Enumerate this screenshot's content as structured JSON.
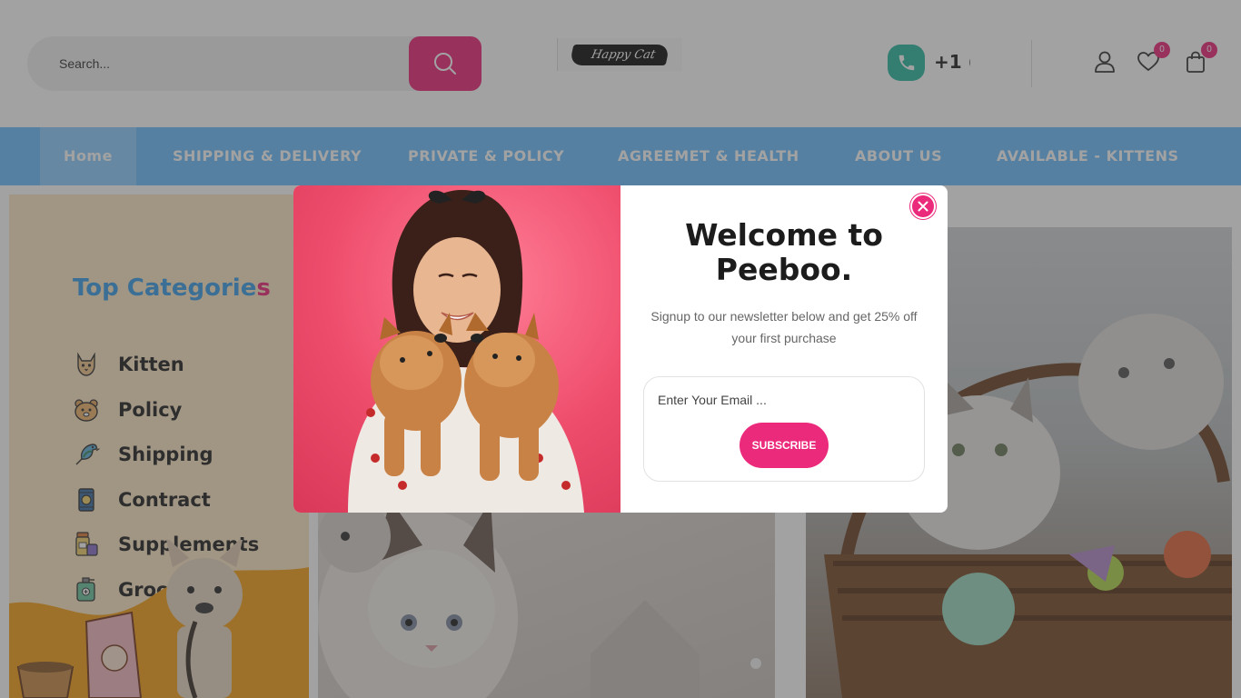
{
  "search": {
    "placeholder": "Search..."
  },
  "logo": {
    "text": "Happy Cat"
  },
  "contact": {
    "phone": "+1 ("
  },
  "header_icons": {
    "wishlist_count": "0",
    "cart_count": "0"
  },
  "nav": {
    "items": [
      {
        "label": "Home"
      },
      {
        "label": "SHIPPING & DELIVERY"
      },
      {
        "label": "PRIVATE & POLICY"
      },
      {
        "label": "AGREEMET & HEALTH"
      },
      {
        "label": "ABOUT US"
      },
      {
        "label": "AVAILABLE - KITTENS"
      }
    ]
  },
  "sidebar": {
    "title_main": "Top Categorie",
    "title_last": "s",
    "items": [
      {
        "label": "Kitten",
        "icon": "kitten-icon"
      },
      {
        "label": "Policy",
        "icon": "hamster-icon"
      },
      {
        "label": "Shipping",
        "icon": "bird-icon"
      },
      {
        "label": "Contract",
        "icon": "food-can-icon"
      },
      {
        "label": "Supplements",
        "icon": "supplements-icon"
      },
      {
        "label": "Grooming",
        "icon": "grooming-icon"
      }
    ]
  },
  "popup": {
    "title_line1": "Welcome to",
    "title_line2": "Peeboo.",
    "description": "Signup to our newsletter below and get 25% off your first purchase",
    "email_placeholder": "Enter Your Email ...",
    "subscribe_label": "SUBSCRIBE"
  },
  "colors": {
    "accent_pink": "#ec2a7c",
    "nav_blue": "#6cbfff",
    "phone_teal": "#2bb8a1",
    "title_blue": "#3a9de6"
  }
}
